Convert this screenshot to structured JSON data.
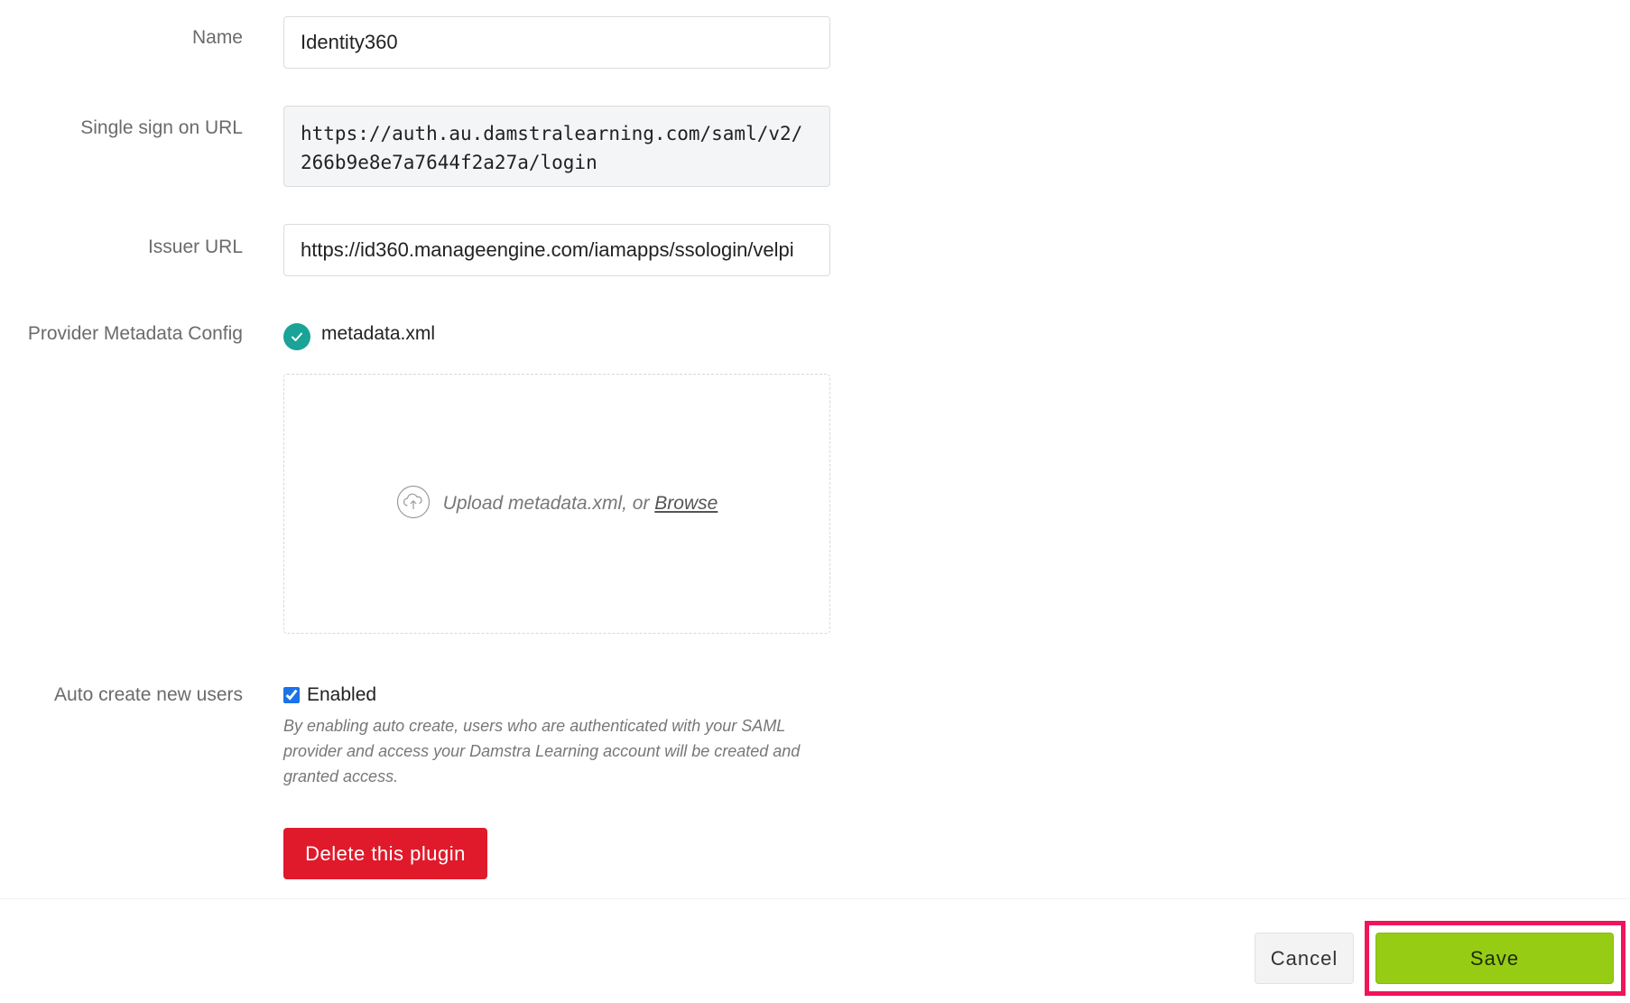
{
  "form": {
    "name_label": "Name",
    "name_value": "Identity360",
    "sso_label": "Single sign on URL",
    "sso_value": "https://auth.au.damstralearning.com/saml/v2/266b9e8e7a7644f2a27a/login",
    "issuer_label": "Issuer URL",
    "issuer_value": "https://id360.manageengine.com/iamapps/ssologin/velpi",
    "metadata_label": "Provider Metadata Config",
    "metadata_file": "metadata.xml",
    "upload_text": "Upload metadata.xml, or",
    "browse_link": "Browse",
    "auto_create_label": "Auto create new users",
    "enabled_label": "Enabled",
    "enabled_checked": true,
    "help_text": "By enabling auto create, users who are authenticated with your SAML provider and access your Damstra Learning account will be created and granted access.",
    "delete_button": "Delete this plugin"
  },
  "footer": {
    "cancel_button": "Cancel",
    "save_button": "Save"
  },
  "colors": {
    "delete": "#e01a2b",
    "save": "#97cc15",
    "check": "#1aa397",
    "highlight": "#f0145a"
  }
}
